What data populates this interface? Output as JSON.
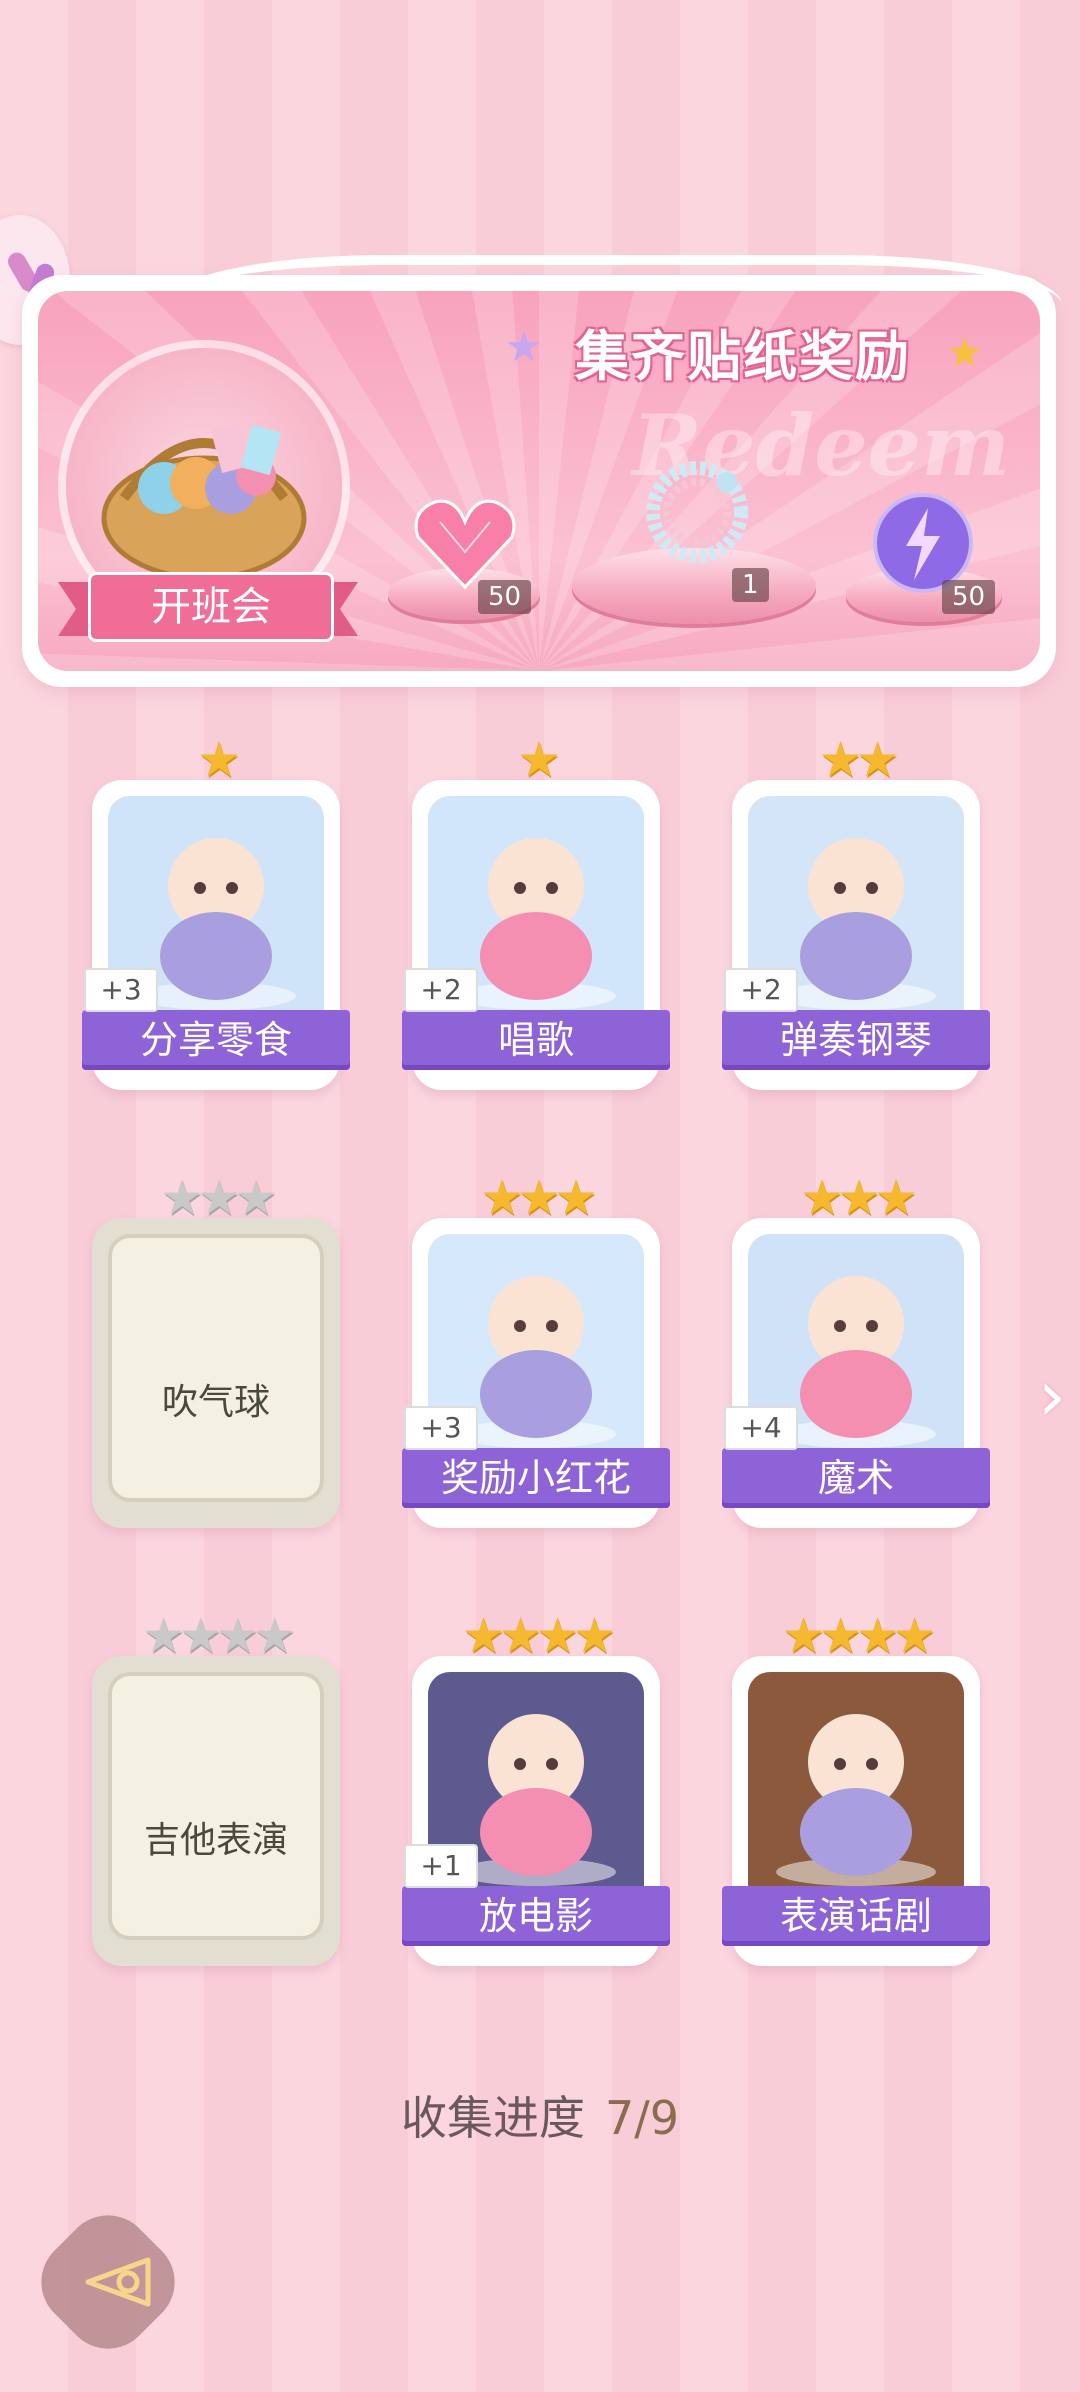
{
  "banner": {
    "title": "集齐贴纸奖励",
    "watermark": "Redeem",
    "event_label": "开班会",
    "rewards": [
      {
        "icon": "heart-gem-icon",
        "count": "50"
      },
      {
        "icon": "crystal-bracelet-icon",
        "count": "1"
      },
      {
        "icon": "lightning-orb-icon",
        "count": "50"
      }
    ]
  },
  "cards": [
    {
      "name": "分享零食",
      "stars": 1,
      "unlocked": true,
      "bonus": "+3",
      "icon": "snack-basket-icon"
    },
    {
      "name": "唱歌",
      "stars": 1,
      "unlocked": true,
      "bonus": "+2",
      "icon": "singing-peacock-icon"
    },
    {
      "name": "弹奏钢琴",
      "stars": 2,
      "unlocked": true,
      "bonus": "+2",
      "icon": "piano-boy-icon"
    },
    {
      "name": "吹气球",
      "stars": 3,
      "unlocked": false,
      "bonus": "",
      "icon": ""
    },
    {
      "name": "奖励小红花",
      "stars": 3,
      "unlocked": true,
      "bonus": "+3",
      "icon": "bunny-flower-icon"
    },
    {
      "name": "魔术",
      "stars": 3,
      "unlocked": true,
      "bonus": "+4",
      "icon": "magician-girl-icon"
    },
    {
      "name": "吉他表演",
      "stars": 4,
      "unlocked": false,
      "bonus": "",
      "icon": ""
    },
    {
      "name": "放电影",
      "stars": 4,
      "unlocked": true,
      "bonus": "+1",
      "icon": "popcorn-girl-icon"
    },
    {
      "name": "表演话剧",
      "stars": 4,
      "unlocked": true,
      "bonus": "",
      "icon": "cat-actress-icon"
    }
  ],
  "progress": {
    "label": "收集进度",
    "value": "7/9"
  },
  "colors": {
    "accent": "#8f63d8",
    "gold": "#f5b82e",
    "pink": "#f06d98"
  }
}
